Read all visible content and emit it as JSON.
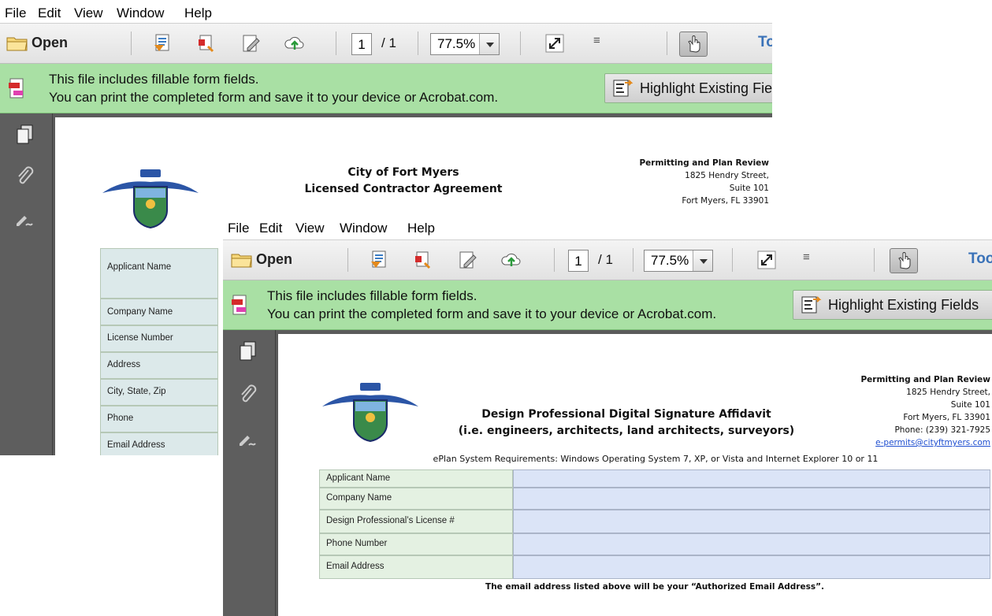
{
  "menu": [
    "File",
    "Edit",
    "View",
    "Window",
    "Help"
  ],
  "toolbar": {
    "open_label": "Open",
    "page_current": "1",
    "page_total": "/ 1",
    "zoom": "77.5%",
    "tools_label": "Tools"
  },
  "infobar": {
    "line1": "This file includes fillable form fields.",
    "line2": "You can print the completed form and save it to your device or Acrobat.com.",
    "highlight_label": "Highlight Existing Fields"
  },
  "doc1": {
    "title_line1": "City of Fort Myers",
    "title_line2": "Licensed Contractor Agreement",
    "office": "Permitting and Plan Review",
    "street": "1825 Hendry Street,",
    "suite": "Suite 101",
    "city": "Fort Myers, FL 33901",
    "fields": [
      "Applicant Name",
      "Company Name",
      "License Number",
      "Address",
      "City, State, Zip",
      "Phone",
      "Email Address"
    ]
  },
  "doc2": {
    "title_line1": "Design Professional Digital Signature Affidavit",
    "title_line2": "(i.e. engineers, architects, land architects, surveyors)",
    "office": "Permitting and Plan Review",
    "street": "1825 Hendry Street,",
    "suite": "Suite 101",
    "city": "Fort Myers, FL 33901",
    "phone": "Phone: (239) 321-7925",
    "email": "e-permits@cityftmyers.com",
    "requirements": "ePlan System Requirements: Windows Operating System 7, XP, or Vista and Internet Explorer 10 or 11",
    "fields": [
      "Applicant Name",
      "Company Name",
      "Design Professional’s License #",
      "Phone Number",
      "Email Address"
    ],
    "note": "The email address listed above will be your “Authorized Email Address”."
  },
  "colors": {
    "infobar": "#a9e0a4",
    "field_label_bg": "#e4f1e2",
    "field_label_bg_doc1": "#dce9ea",
    "field_value_bg": "#dbe4f7",
    "link": "#1f4fd0",
    "tools_text": "#3a72b8"
  },
  "icons": [
    "folder-icon",
    "save-icon",
    "print-icon",
    "edit-icon",
    "upload-cloud-icon",
    "fullscreen-icon",
    "hand-tool-icon",
    "pages-icon",
    "attachment-icon",
    "signature-icon",
    "form-icon",
    "highlight-fields-icon",
    "city-seal-logo"
  ]
}
